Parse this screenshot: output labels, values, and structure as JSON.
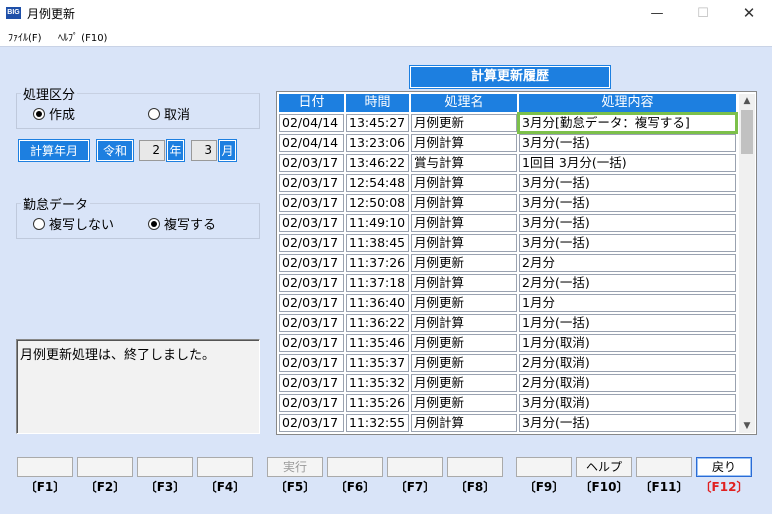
{
  "window": {
    "icon_text": "BIG",
    "title": "月例更新",
    "minimize_icon": "minimize-icon",
    "maximize_icon": "maximize-icon",
    "close_icon": "close-icon"
  },
  "menu": [
    "ﾌｧｲﾙ(F)",
    "ﾍﾙﾌﾟ (F10)"
  ],
  "processing_type": {
    "label": "処理区分",
    "options": [
      {
        "label": "作成",
        "selected": true
      },
      {
        "label": "取消",
        "selected": false
      }
    ]
  },
  "calc_period": {
    "label": "計算年月",
    "era": "令和",
    "year": "2",
    "year_unit": "年",
    "month": "3",
    "month_unit": "月"
  },
  "attendance": {
    "label": "勤怠データ",
    "options": [
      {
        "label": "複写しない",
        "selected": false
      },
      {
        "label": "複写する",
        "selected": true
      }
    ]
  },
  "message": "月例更新処理は、終了しました。",
  "history": {
    "title": "計算更新履歴",
    "columns": [
      "日付",
      "時間",
      "処理名",
      "処理内容"
    ],
    "rows": [
      [
        "02/04/14",
        "13:45:27",
        "月例更新",
        "3月分[勤怠データ：複写する]"
      ],
      [
        "02/04/14",
        "13:23:06",
        "月例計算",
        "3月分(一括)"
      ],
      [
        "02/03/17",
        "13:46:22",
        "賞与計算",
        "1回目 3月分(一括)"
      ],
      [
        "02/03/17",
        "12:54:48",
        "月例計算",
        "3月分(一括)"
      ],
      [
        "02/03/17",
        "12:50:08",
        "月例計算",
        "3月分(一括)"
      ],
      [
        "02/03/17",
        "11:49:10",
        "月例計算",
        "3月分(一括)"
      ],
      [
        "02/03/17",
        "11:38:45",
        "月例計算",
        "3月分(一括)"
      ],
      [
        "02/03/17",
        "11:37:26",
        "月例更新",
        "2月分"
      ],
      [
        "02/03/17",
        "11:37:18",
        "月例計算",
        "2月分(一括)"
      ],
      [
        "02/03/17",
        "11:36:40",
        "月例更新",
        "1月分"
      ],
      [
        "02/03/17",
        "11:36:22",
        "月例計算",
        "1月分(一括)"
      ],
      [
        "02/03/17",
        "11:35:46",
        "月例更新",
        "1月分(取消)"
      ],
      [
        "02/03/17",
        "11:35:37",
        "月例更新",
        "2月分(取消)"
      ],
      [
        "02/03/17",
        "11:35:32",
        "月例更新",
        "2月分(取消)"
      ],
      [
        "02/03/17",
        "11:35:26",
        "月例更新",
        "3月分(取消)"
      ],
      [
        "02/03/17",
        "11:32:55",
        "月例計算",
        "3月分(一括)"
      ]
    ],
    "highlight_color": "#7cc04a"
  },
  "function_keys": [
    {
      "key": "〔F1〕",
      "label": ""
    },
    {
      "key": "〔F2〕",
      "label": ""
    },
    {
      "key": "〔F3〕",
      "label": ""
    },
    {
      "key": "〔F4〕",
      "label": ""
    },
    {
      "key": "〔F5〕",
      "label": "実行"
    },
    {
      "key": "〔F6〕",
      "label": ""
    },
    {
      "key": "〔F7〕",
      "label": ""
    },
    {
      "key": "〔F8〕",
      "label": ""
    },
    {
      "key": "〔F9〕",
      "label": ""
    },
    {
      "key": "〔F10〕",
      "label": "ヘルプ"
    },
    {
      "key": "〔F11〕",
      "label": ""
    },
    {
      "key": "〔F12〕",
      "label": "戻り"
    }
  ],
  "colors": {
    "accent": "#1d7fe0",
    "background": "#d9e4f8",
    "f12_label": "#e02020"
  }
}
